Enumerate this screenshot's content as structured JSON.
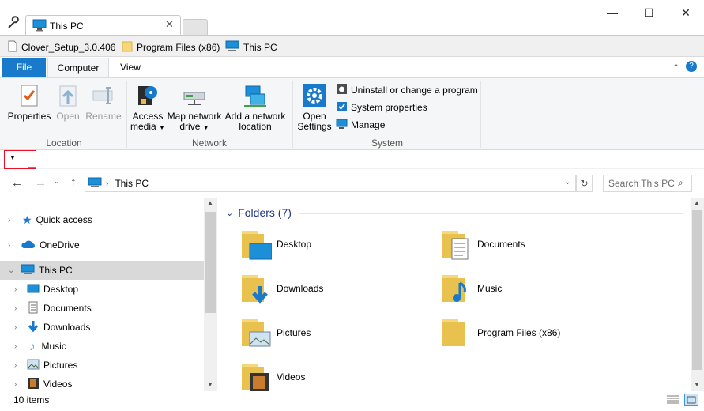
{
  "window": {
    "tab_title": "This PC"
  },
  "groups": {
    "items": [
      "Clover_Setup_3.0.406",
      "Program Files (x86)",
      "This PC"
    ]
  },
  "ribbon_tabs": [
    "File",
    "Computer",
    "View"
  ],
  "ribbon": {
    "location": {
      "label": "Location",
      "properties": "Properties",
      "open": "Open",
      "rename": "Rename"
    },
    "network": {
      "label": "Network",
      "access_media_1": "Access",
      "access_media_2": "media",
      "map_drive_1": "Map network",
      "map_drive_2": "drive",
      "add_location_1": "Add a network",
      "add_location_2": "location"
    },
    "system": {
      "label": "System",
      "open_settings_1": "Open",
      "open_settings_2": "Settings",
      "uninstall": "Uninstall or change a program",
      "sys_props": "System properties",
      "manage": "Manage"
    }
  },
  "address": {
    "crumb": "This PC",
    "search_placeholder": "Search This PC"
  },
  "nav": {
    "quick_access": "Quick access",
    "onedrive": "OneDrive",
    "this_pc": "This PC",
    "children": [
      "Desktop",
      "Documents",
      "Downloads",
      "Music",
      "Pictures",
      "Videos"
    ]
  },
  "content": {
    "group_header": "Folders (7)",
    "folders": [
      "Desktop",
      "Documents",
      "Downloads",
      "Music",
      "Pictures",
      "Program Files (x86)",
      "Videos"
    ]
  },
  "status": {
    "items_count": "10 items"
  },
  "colors": {
    "accent": "#1979ca",
    "selection": "#d9d9d9",
    "folder": "#f6d779",
    "header_blue": "#1e3287"
  }
}
